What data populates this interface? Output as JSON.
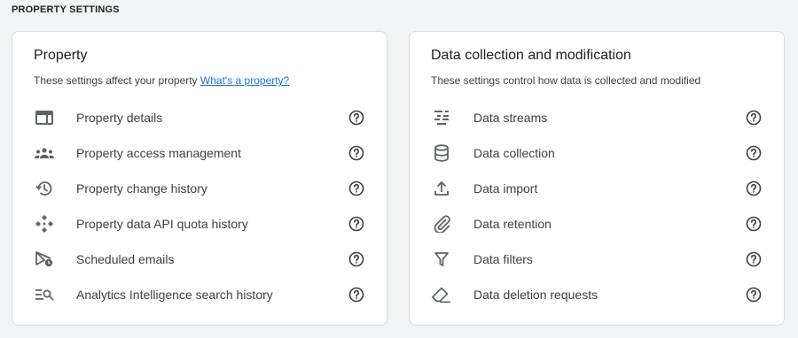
{
  "section_title": "PROPERTY SETTINGS",
  "property_card": {
    "title": "Property",
    "subtitle_text": "These settings affect your property",
    "subtitle_link": "What's a property?",
    "items": [
      {
        "label": "Property details",
        "icon": "property-details-icon"
      },
      {
        "label": "Property access management",
        "icon": "people-icon"
      },
      {
        "label": "Property change history",
        "icon": "history-icon"
      },
      {
        "label": "Property data API quota history",
        "icon": "api-quota-icon"
      },
      {
        "label": "Scheduled emails",
        "icon": "scheduled-email-icon"
      },
      {
        "label": "Analytics Intelligence search history",
        "icon": "search-history-icon"
      }
    ]
  },
  "data_card": {
    "title": "Data collection and modification",
    "subtitle_text": "These settings control how data is collected and modified",
    "items": [
      {
        "label": "Data streams",
        "icon": "data-streams-icon"
      },
      {
        "label": "Data collection",
        "icon": "database-icon"
      },
      {
        "label": "Data import",
        "icon": "upload-icon"
      },
      {
        "label": "Data retention",
        "icon": "attachment-icon"
      },
      {
        "label": "Data filters",
        "icon": "filter-icon"
      },
      {
        "label": "Data deletion requests",
        "icon": "eraser-icon"
      }
    ]
  },
  "colors": {
    "link": "#1a73e8",
    "icon": "#5f6368",
    "background": "#f1f3f4"
  }
}
